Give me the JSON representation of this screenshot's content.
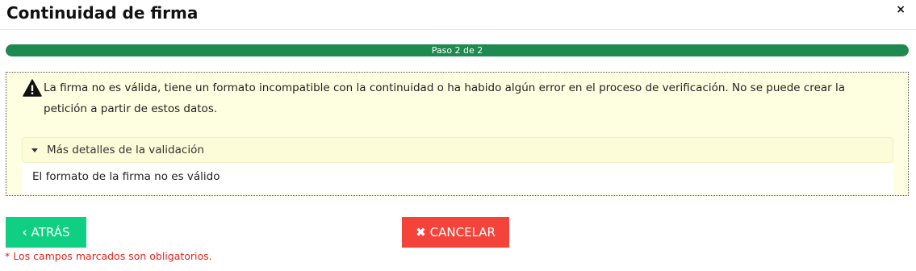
{
  "dialog": {
    "title": "Continuidad de firma",
    "close_icon": "×"
  },
  "progress": {
    "label": "Paso 2 de 2",
    "fraction": 1.0,
    "color": "#1e8a4f"
  },
  "alert": {
    "icon": "warning-icon",
    "message": "La firma no es válida, tiene un formato incompatible con la continuidad o ha habido algún error en el proceso de verificación. No se puede crear la petición a partir de estos datos.",
    "details_label": "Más detalles de la validación",
    "details_text": "El formato de la firma no es válido",
    "background": "#fefee0"
  },
  "buttons": {
    "back_icon": "‹",
    "back_label": "ATRÁS",
    "back_color": "#0fcf82",
    "cancel_icon": "✖",
    "cancel_label": "CANCELAR",
    "cancel_color": "#f4433a"
  },
  "footer": {
    "required_note": "* Los campos marcados son obligatorios."
  }
}
